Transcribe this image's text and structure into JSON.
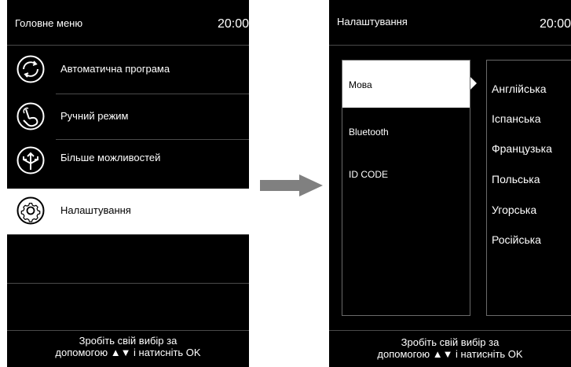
{
  "main_menu": {
    "title": "Головне меню",
    "time": "20:00",
    "items": [
      {
        "label": "Автоматична програма",
        "icon": "auto-program-icon"
      },
      {
        "label": "Ручний режим",
        "icon": "hand-icon"
      },
      {
        "label": "Більше можливостей",
        "icon": "directions-icon"
      },
      {
        "label": "Налаштування",
        "icon": "gear-icon",
        "selected": true
      }
    ],
    "footer_line1": "Зробіть свій вибір за",
    "footer_line2": "допомогою ▲▼ і натисніть OK"
  },
  "settings": {
    "title": "Налаштування",
    "time": "20:00",
    "items": [
      {
        "label": "Мова",
        "selected": true
      },
      {
        "label": "Bluetooth"
      },
      {
        "label": "ID CODE"
      }
    ],
    "languages": [
      "Англійська",
      "Іспанська",
      "Французька",
      "Польська",
      "Угорська",
      "Російська"
    ],
    "footer_line1": "Зробіть свій вибір за",
    "footer_line2": "допомогою ▲▼ і натисніть OK"
  },
  "colors": {
    "screen_bg": "#000000",
    "text": "#ffffff",
    "selected_bg": "#ffffff",
    "arrow": "#808080"
  }
}
